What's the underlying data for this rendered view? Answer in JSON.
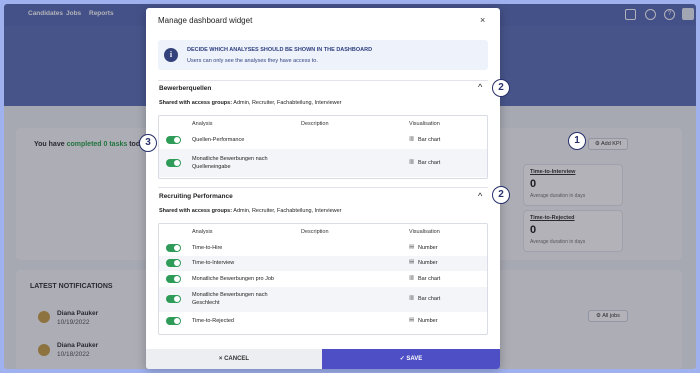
{
  "nav": {
    "items": [
      "Candidates",
      "Jobs",
      "Reports"
    ],
    "icons": [
      "chat-icon",
      "settings-icon",
      "help-icon"
    ],
    "help_glyph": "?"
  },
  "background": {
    "tasks_prefix": "You have",
    "tasks_highlight": "completed 0 tasks",
    "tasks_suffix": "today",
    "add_kpi": "Add KPI",
    "kpis": [
      {
        "title": "Time-to-Interview",
        "value": "0",
        "sub": "Average duration in days"
      },
      {
        "title": "Time-to-Rejected",
        "value": "0",
        "sub": "Average duration in days"
      }
    ],
    "notifications_title": "LATEST NOTIFICATIONS",
    "notifications": [
      {
        "name": "Diana Pauker",
        "date": "10/19/2022"
      },
      {
        "name": "Diana Pauker",
        "date": "10/18/2022"
      }
    ],
    "all_jobs": "All jobs"
  },
  "modal": {
    "title": "Manage dashboard widget",
    "close": "×",
    "info_heading": "DECIDE WHICH ANALYSES SHOULD BE SHOWN IN THE DASHBOARD",
    "info_sub": "Users can only see the analyses they have access to.",
    "info_glyph": "i",
    "columns": {
      "analysis": "Analysis",
      "description": "Description",
      "visualisation": "Visualisation"
    },
    "shared_label": "Shared with access groups:",
    "sections": [
      {
        "title": "Bewerberquellen",
        "chevron": "^",
        "groups": "Admin, Recruiter, Fachabteilung, Interviewer",
        "rows": [
          {
            "analysis": "Quellen-Performance",
            "visualisation": "Bar chart",
            "enabled": true
          },
          {
            "analysis": "Monatliche Bewerbungen nach Quelleneingabe",
            "visualisation": "Bar chart",
            "enabled": true
          }
        ]
      },
      {
        "title": "Recruiting Performance",
        "chevron": "^",
        "groups": "Admin, Recruiter, Fachabteilung, Interviewer",
        "rows": [
          {
            "analysis": "Time-to-Hire",
            "visualisation": "Number",
            "enabled": true
          },
          {
            "analysis": "Time-to-Interview",
            "visualisation": "Number",
            "enabled": true
          },
          {
            "analysis": "Monatliche Bewerbungen pro Job",
            "visualisation": "Bar chart",
            "enabled": true
          },
          {
            "analysis": "Monatliche Bewerbungen nach Geschlecht",
            "visualisation": "Bar chart",
            "enabled": true
          },
          {
            "analysis": "Time-to-Rejected",
            "visualisation": "Number",
            "enabled": true
          }
        ]
      }
    ],
    "cancel": "× CANCEL",
    "save": "✓ SAVE"
  },
  "markers": [
    "1",
    "2",
    "2",
    "3"
  ],
  "colors": {
    "accent": "#4e4fc4",
    "toggle_on": "#2f9b58",
    "nav": "#5b6fb8",
    "info": "#2f3f7f"
  }
}
